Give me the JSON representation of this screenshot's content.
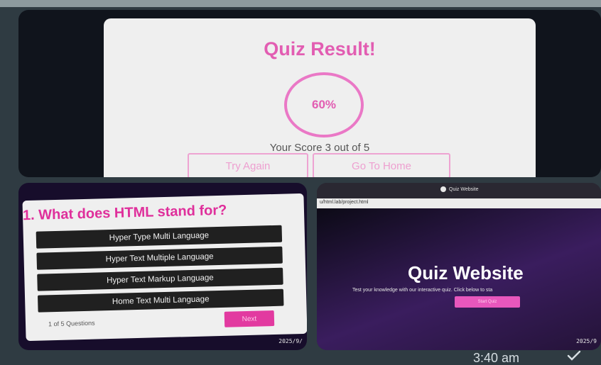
{
  "result_tile": {
    "title": "Quiz Result!",
    "score_percent": "60%",
    "score_text": "Your Score 3 out of 5",
    "try_again_label": "Try Again",
    "go_home_label": "Go To Home"
  },
  "question_tile": {
    "question": "1. What does HTML stand for?",
    "options": [
      "Hyper Type Multi Language",
      "Hyper Text Multiple Language",
      "Hyper Text Markup Language",
      "Home Text Multi Language"
    ],
    "progress_text": "1 of 5 Questions",
    "next_label": "Next",
    "date_stamp": "2025/9/"
  },
  "site_tile": {
    "window_title": "Quiz Website",
    "address": "u/html.lab/project.html",
    "hero_title": "Quiz Website",
    "hero_subtitle": "Test your knowledge with our interactive quiz. Click below to sta",
    "start_label": "Start Quiz",
    "date_stamp": "2025/9"
  },
  "chat": {
    "time": "3:40 am"
  },
  "colors": {
    "accent_pink": "#e25db2",
    "card_background": "#efefef",
    "chat_background": "#2f3b42"
  }
}
